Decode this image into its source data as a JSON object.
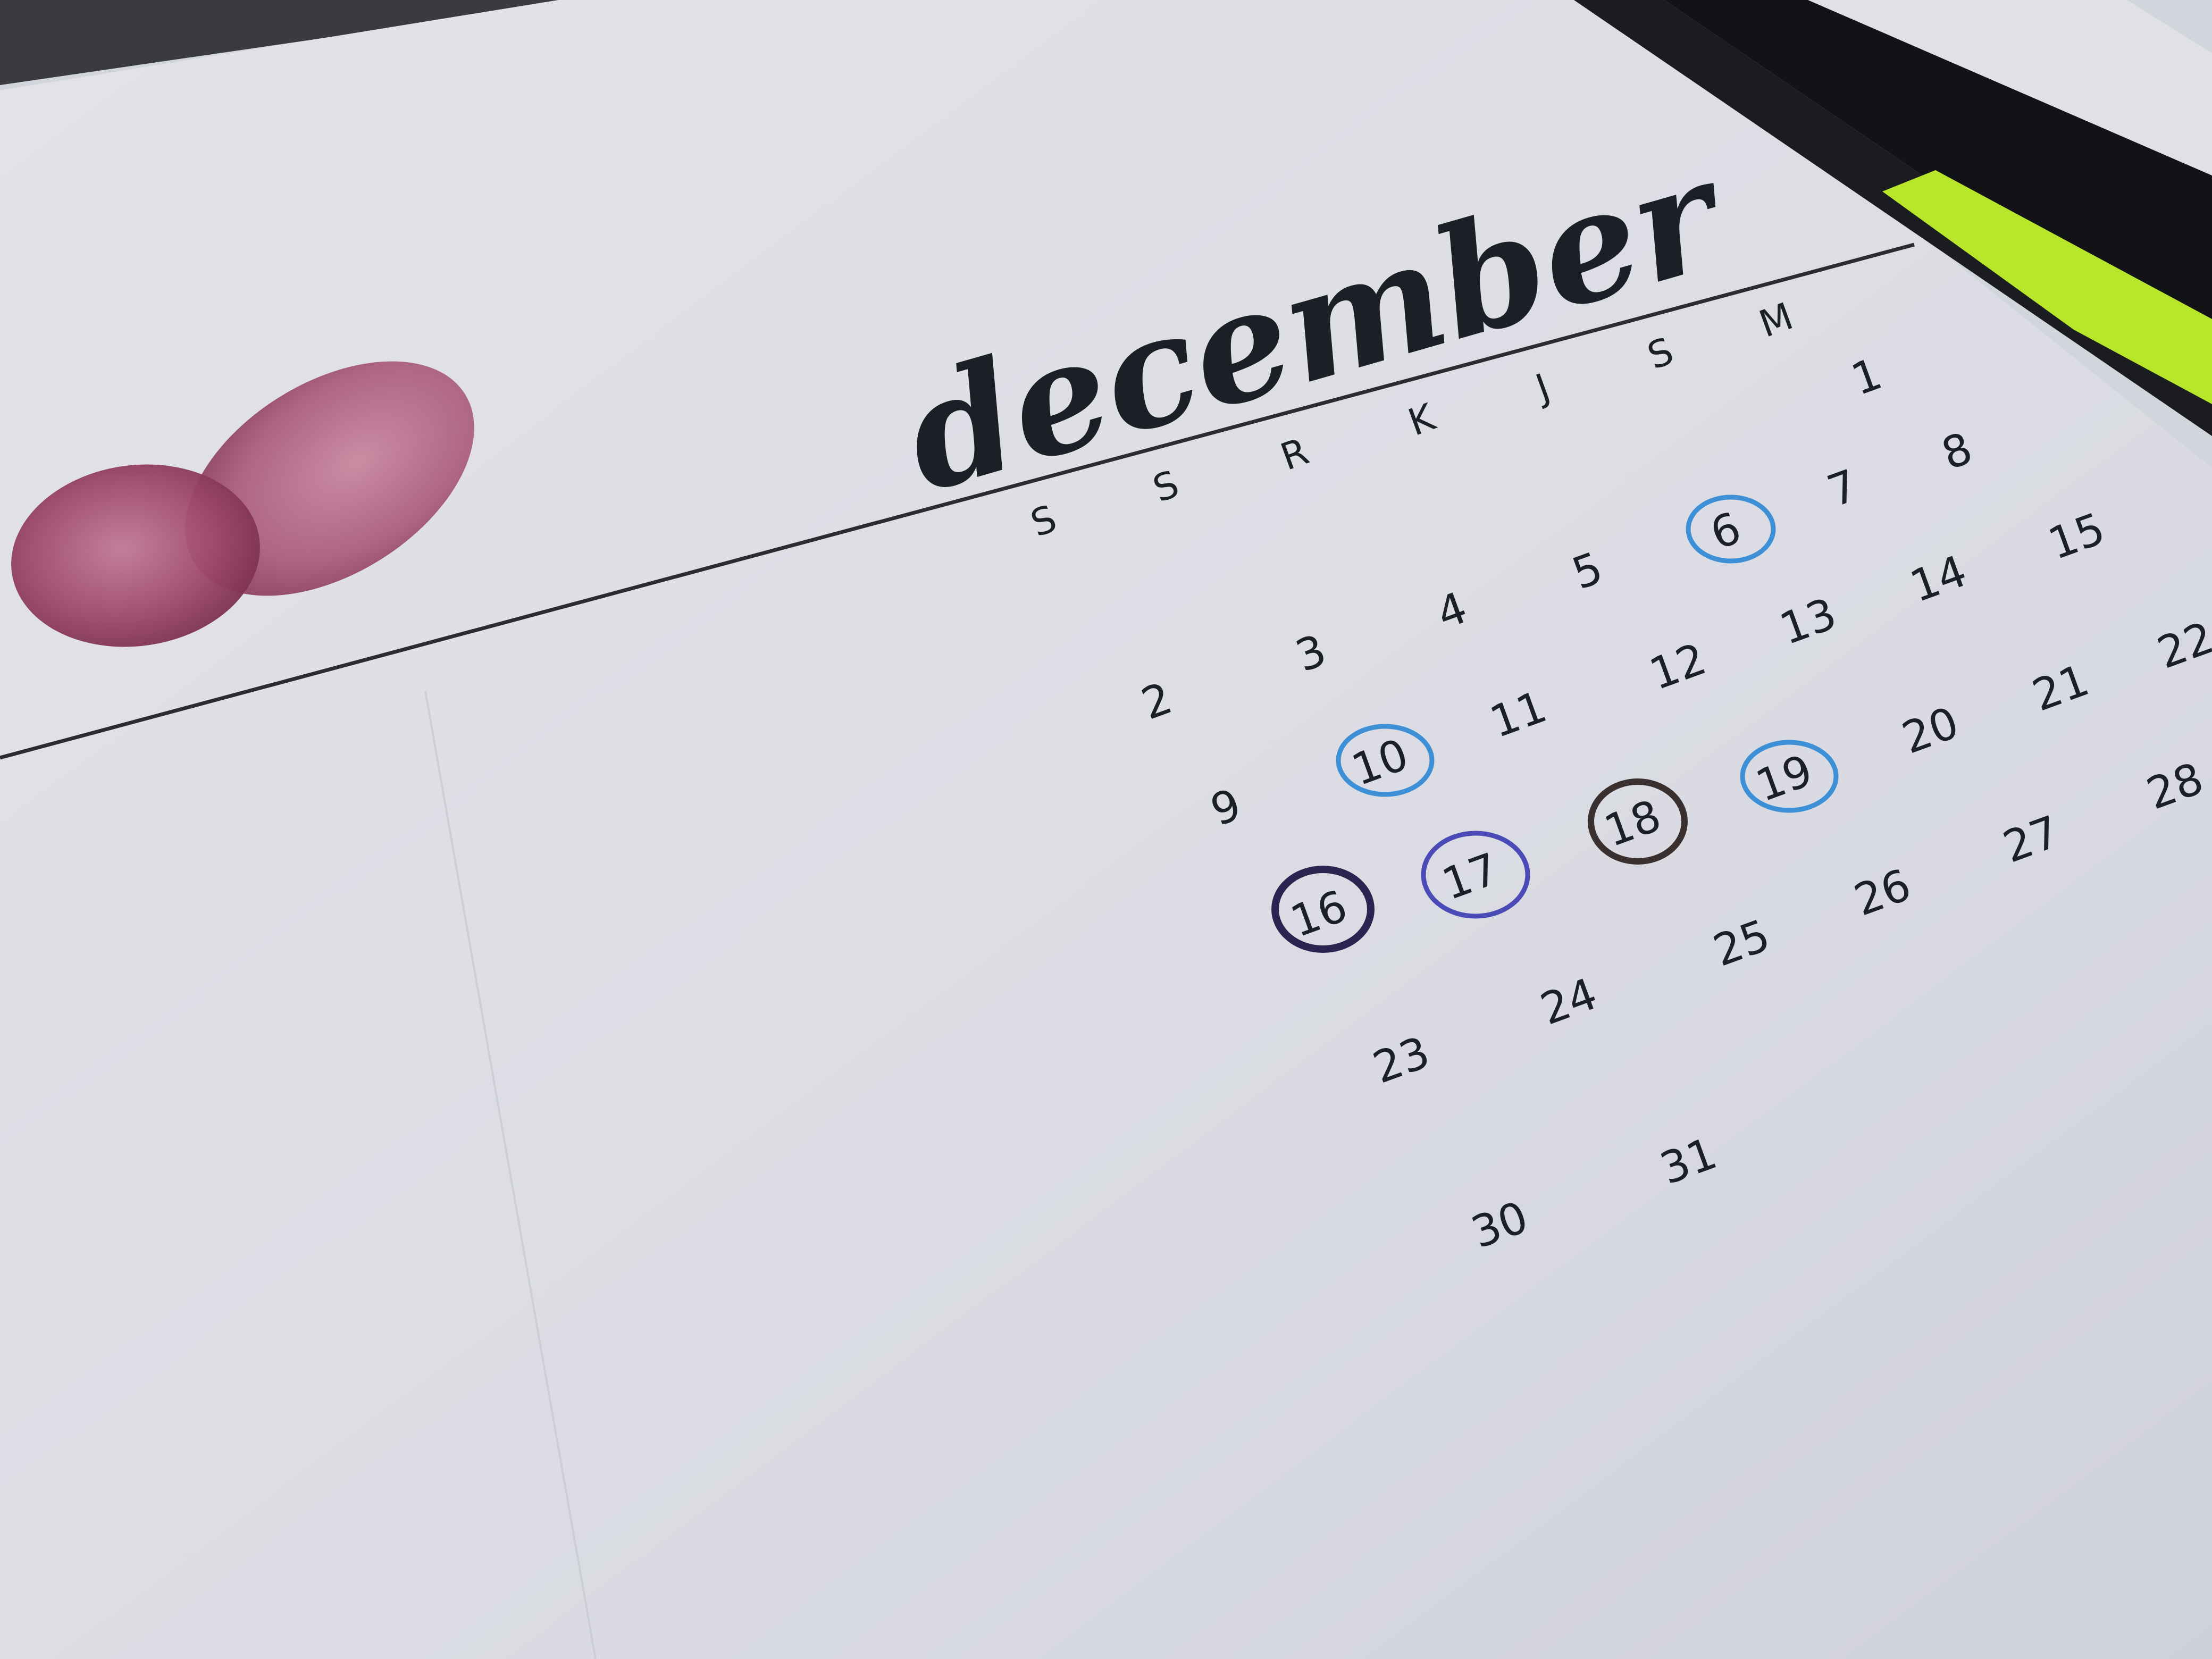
{
  "photo": {
    "subject": "bullet journal page"
  },
  "calendar": {
    "month": "december",
    "weekday_headers": [
      "S",
      "S",
      "R",
      "K",
      "J",
      "S",
      "M"
    ],
    "weeks": [
      [
        "",
        "",
        "",
        "",
        "",
        "",
        "1"
      ],
      [
        "",
        "2",
        "3",
        "4",
        "5",
        "6",
        "7",
        "8"
      ],
      [
        "9",
        "10",
        "11",
        "12",
        "13",
        "14",
        "15"
      ],
      [
        "16",
        "17",
        "18",
        "19",
        "20",
        "21",
        "22"
      ],
      [
        "23",
        "24",
        "25",
        "26",
        "27",
        "28"
      ],
      [
        "30",
        "31"
      ]
    ],
    "circled_days": [
      {
        "day": "6",
        "color": "#3d8fd6"
      },
      {
        "day": "10",
        "color": "#3d8fd6"
      },
      {
        "day": "19",
        "color": "#3d8fd6"
      },
      {
        "day": "16",
        "color": "#2c2450"
      },
      {
        "day": "17",
        "color": "#4b4bb8"
      },
      {
        "day": "18",
        "color": "#3a3030"
      }
    ]
  },
  "colors": {
    "paper": "#e4e5eb",
    "ink": "#1c1f26",
    "watercolor": "#a04a6e",
    "highlighter": "#b8e62a"
  }
}
